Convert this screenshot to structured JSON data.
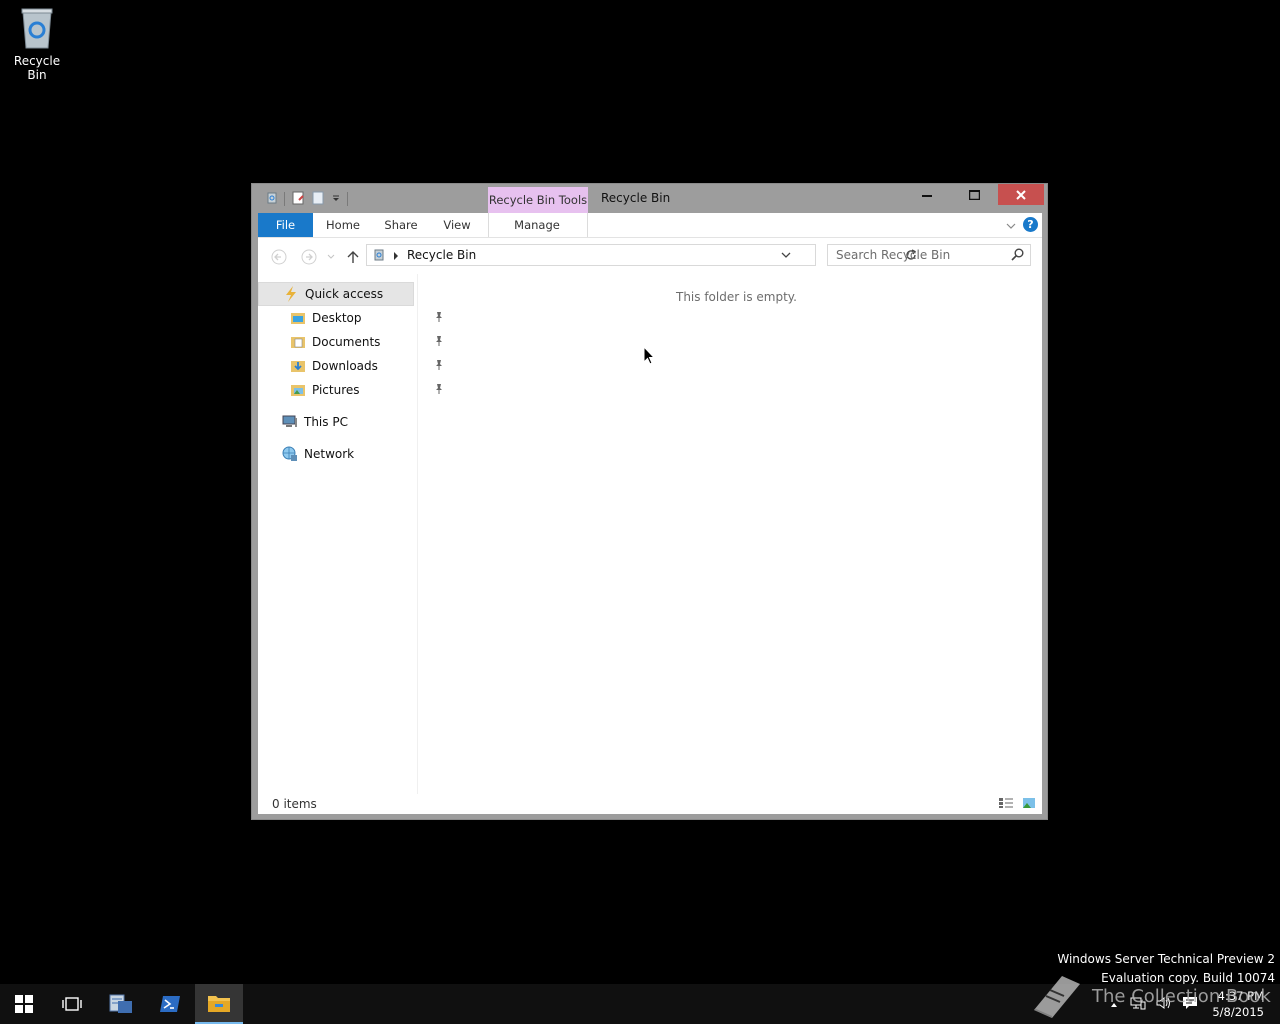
{
  "desktop": {
    "recycle_bin_label": "Recycle Bin"
  },
  "window": {
    "title": "Recycle Bin",
    "context_tab_group": "Recycle Bin Tools",
    "ribbon_tabs": {
      "file": "File",
      "home": "Home",
      "share": "Share",
      "view": "View",
      "manage": "Manage"
    },
    "address": {
      "path": "Recycle Bin"
    },
    "search": {
      "placeholder": "Search Recycle Bin"
    },
    "nav": {
      "quick_access": "Quick access",
      "desktop": "Desktop",
      "documents": "Documents",
      "downloads": "Downloads",
      "pictures": "Pictures",
      "this_pc": "This PC",
      "network": "Network"
    },
    "content": {
      "empty_message": "This folder is empty."
    },
    "status": {
      "item_count": "0 items"
    }
  },
  "watermark": {
    "line1": "Windows Server Technical Preview 2",
    "line2": "Evaluation copy. Build 10074"
  },
  "overlay_watermark": "The Collection Book",
  "taskbar": {
    "time": "4:37 PM",
    "date": "5/8/2015"
  },
  "colors": {
    "file_tab": "#1979ca",
    "context_tab": "#e7c1ef",
    "close_button": "#c7504f",
    "taskbar": "#101010"
  }
}
